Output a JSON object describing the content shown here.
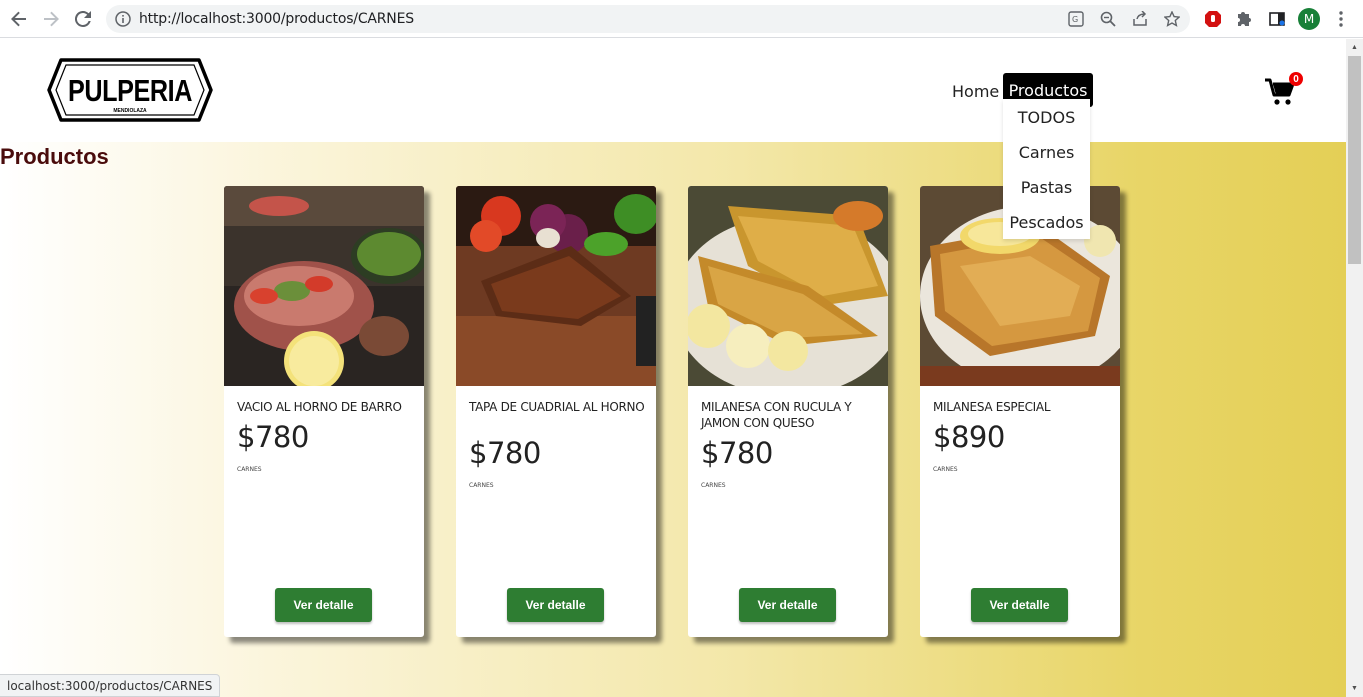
{
  "browser": {
    "url": "http://localhost:3000/productos/CARNES",
    "profile_initial": "M",
    "status_url": "localhost:3000/productos/CARNES"
  },
  "header": {
    "logo_text": "PULPERIA",
    "logo_subtext": "MENDIOLAZA",
    "nav_home": "Home",
    "nav_productos": "Productos",
    "cart_count": "0"
  },
  "dropdown": {
    "items": [
      "TODOS",
      "Carnes",
      "Pastas",
      "Pescados"
    ]
  },
  "page_title": "Productos",
  "products": [
    {
      "name": "VACIO AL HORNO DE BARRO",
      "price": "$780",
      "category": "CARNES",
      "button": "Ver detalle"
    },
    {
      "name": "TAPA DE CUADRIAL AL HORNO",
      "price": "$780",
      "category": "CARNES",
      "button": "Ver detalle"
    },
    {
      "name": "MILANESA CON RUCULA Y JAMON CON QUESO",
      "price": "$780",
      "category": "CARNES",
      "button": "Ver detalle"
    },
    {
      "name": "MILANESA ESPECIAL",
      "price": "$890",
      "category": "CARNES",
      "button": "Ver detalle"
    }
  ],
  "colors": {
    "title": "#4a0c0c",
    "button": "#2e7d32",
    "nav_active_bg": "#000000",
    "badge": "#ee0000"
  }
}
